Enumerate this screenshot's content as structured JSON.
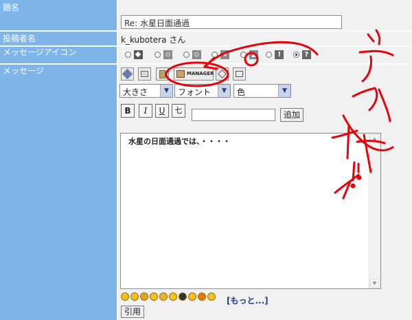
{
  "form": {
    "title_label": "題名",
    "title_value": "Re: 水星日面通過",
    "author_label": "投稿者名",
    "author_value": "k_kubotera さん",
    "icon_label": "メッセージアイコン",
    "icon_glyphs": [
      "!",
      "?"
    ],
    "message_label": "メッセージ",
    "toolbar": {
      "manager_label": "MANAGER"
    },
    "selects": {
      "size": "大きさ",
      "font": "フォント",
      "color": "色"
    },
    "format_buttons": {
      "bold": "B",
      "italic": "I",
      "underline": "U",
      "strike": "七"
    },
    "add_button": "追加",
    "message_text": "水星の日面通過では、・・・・",
    "more_link": "[もっと...]",
    "quote_button": "引用"
  },
  "colors": {
    "label_bg": "#7fb6ea",
    "cell_bg": "#f1f1f1",
    "annotation": "#e8000b"
  }
}
